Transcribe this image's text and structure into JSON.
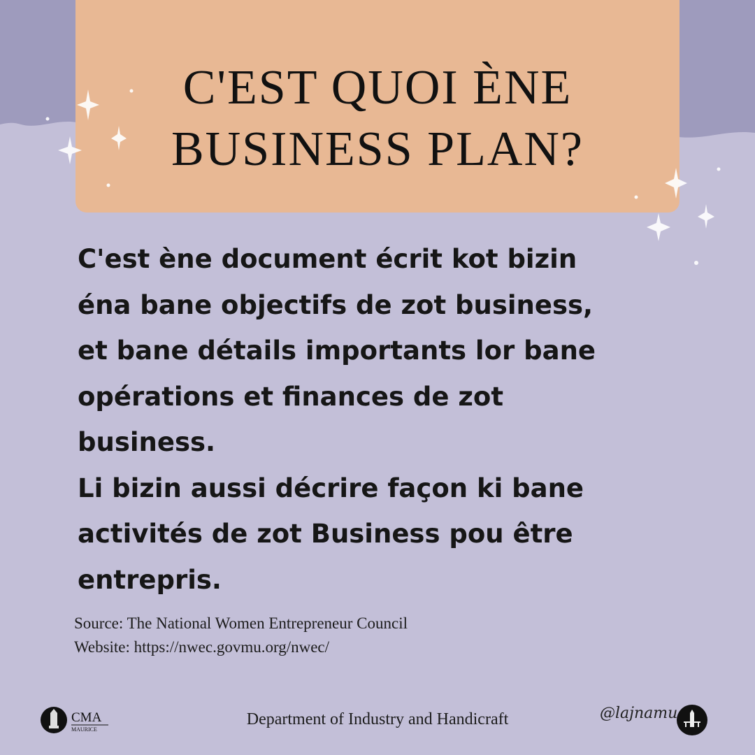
{
  "colors": {
    "background": "#c3bfd8",
    "top_band": "#9e9bbd",
    "title_box": "#e8b894",
    "text": "#161616"
  },
  "title_lines": [
    "C'EST QUOI ÈNE",
    "BUSINESS PLAN?"
  ],
  "body_lines": [
    "C'est ène document écrit kot bizin",
    "éna bane objectifs de zot business,",
    "et bane détails importants lor bane",
    "opérations et finances de zot",
    "business.",
    "Li bizin aussi décrire façon ki bane",
    "activités de zot Business pou être",
    "entrepris."
  ],
  "source": {
    "line1": "Source: The National Women Entrepreneur Council",
    "line2": "Website: https://nwec.govmu.org/nwec/"
  },
  "footer": {
    "department": "Department of Industry and Handicraft",
    "logo_text": "CMA",
    "logo_subtext": "MAURICE",
    "handle": "@lajnamu"
  },
  "icons": [
    "sparkle-icon",
    "cma-logo-icon",
    "lajnamu-logo-icon"
  ]
}
